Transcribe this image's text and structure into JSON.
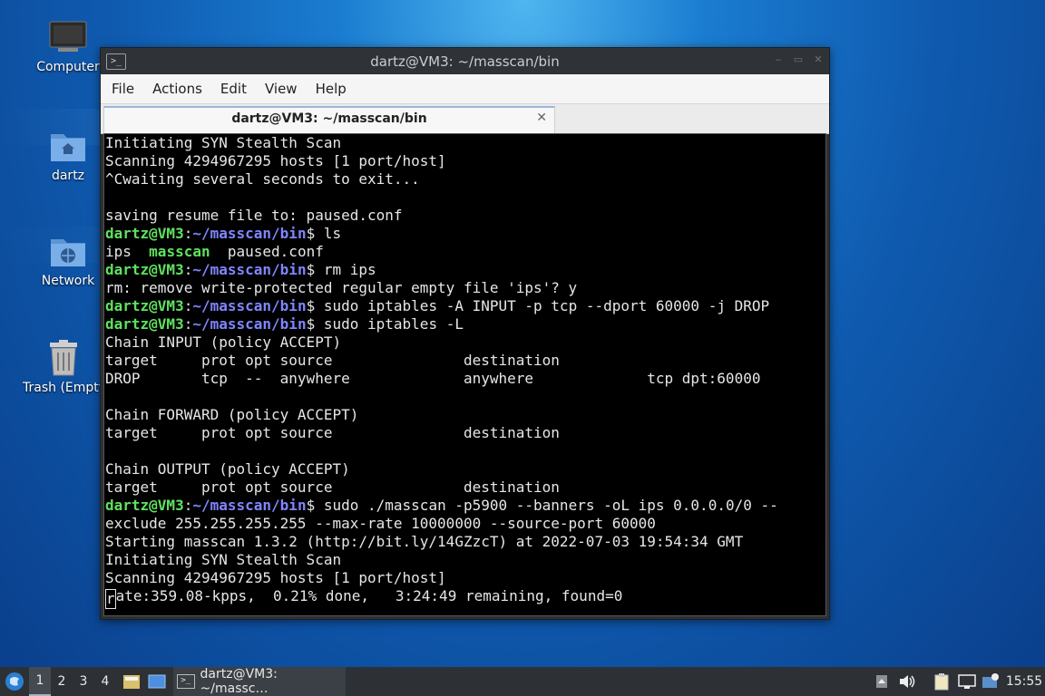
{
  "desktop": {
    "icons": [
      {
        "label": "Computer",
        "icon": "computer-icon"
      },
      {
        "label": "dartz",
        "icon": "home-folder-icon"
      },
      {
        "label": "Network",
        "icon": "network-folder-icon"
      },
      {
        "label": "Trash (Empty)",
        "icon": "trash-icon"
      }
    ]
  },
  "window": {
    "title": "dartz@VM3: ~/masscan/bin",
    "menu": [
      "File",
      "Actions",
      "Edit",
      "View",
      "Help"
    ],
    "tab_label": "dartz@VM3: ~/masscan/bin",
    "tab_close": "✕"
  },
  "terminal": {
    "prompt_user": "dartz@VM3",
    "prompt_path": "~/masscan/bin",
    "lines": [
      {
        "t": "Initiating SYN Stealth Scan"
      },
      {
        "t": "Scanning 4294967295 hosts [1 port/host]"
      },
      {
        "t": "^Cwaiting several seconds to exit..."
      },
      {
        "t": ""
      },
      {
        "t": "saving resume file to: paused.conf"
      },
      {
        "p": "ls"
      },
      {
        "ls": [
          "ips",
          "masscan",
          "paused.conf"
        ]
      },
      {
        "p": "rm ips"
      },
      {
        "t": "rm: remove write-protected regular empty file 'ips'? y"
      },
      {
        "p": "sudo iptables -A INPUT -p tcp --dport 60000 -j DROP"
      },
      {
        "p": "sudo iptables -L"
      },
      {
        "t": "Chain INPUT (policy ACCEPT)"
      },
      {
        "t": "target     prot opt source               destination"
      },
      {
        "t": "DROP       tcp  --  anywhere             anywhere             tcp dpt:60000"
      },
      {
        "t": ""
      },
      {
        "t": "Chain FORWARD (policy ACCEPT)"
      },
      {
        "t": "target     prot opt source               destination"
      },
      {
        "t": ""
      },
      {
        "t": "Chain OUTPUT (policy ACCEPT)"
      },
      {
        "t": "target     prot opt source               destination"
      },
      {
        "p": "sudo ./masscan -p5900 --banners -oL ips 0.0.0.0/0 --"
      },
      {
        "t": "exclude 255.255.255.255 --max-rate 10000000 --source-port 60000"
      },
      {
        "t": "Starting masscan 1.3.2 (http://bit.ly/14GZzcT) at 2022-07-03 19:54:34 GMT"
      },
      {
        "t": "Initiating SYN Stealth Scan"
      },
      {
        "t": "Scanning 4294967295 hosts [1 port/host]"
      },
      {
        "cur": "ate:359.08-kpps,  0.21% done,   3:24:49 remaining, found=0",
        "first": "r"
      }
    ]
  },
  "taskbar": {
    "workspaces": [
      "1",
      "2",
      "3",
      "4"
    ],
    "active_workspace": "1",
    "task_label": "dartz@VM3: ~/massc…",
    "clock": "15:55"
  }
}
